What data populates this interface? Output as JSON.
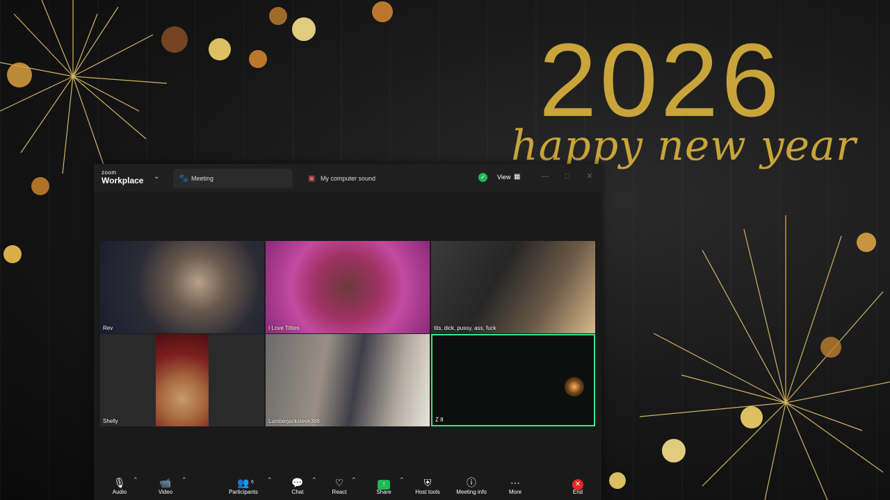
{
  "desktop": {
    "year": "2026",
    "greeting": "happy new year",
    "accent_color": "#c9a43a"
  },
  "app": {
    "brand": "zoom",
    "product": "Workplace"
  },
  "tabs": [
    {
      "label": "Meeting",
      "icon": "paw-icon"
    },
    {
      "label": "My computer sound",
      "icon": "speaker-icon"
    }
  ],
  "header": {
    "view_label": "View",
    "security_color": "#1db954"
  },
  "participants": [
    {
      "name": "Rev"
    },
    {
      "name": "I Love Titties"
    },
    {
      "name": "tits, dick, pussy, ass, fuck"
    },
    {
      "name": "Shelly"
    },
    {
      "name": "Lumberjacksteve388"
    },
    {
      "name": "Z 8",
      "active_speaker": true
    }
  ],
  "toolbar": {
    "audio": "Audio",
    "video": "Video",
    "participants": "Participants",
    "participant_count": "6",
    "chat": "Chat",
    "react": "React",
    "share": "Share",
    "host_tools": "Host tools",
    "meeting_info": "Meeting info",
    "more": "More",
    "end": "End",
    "end_color": "#e02828",
    "share_color": "#1db954"
  }
}
